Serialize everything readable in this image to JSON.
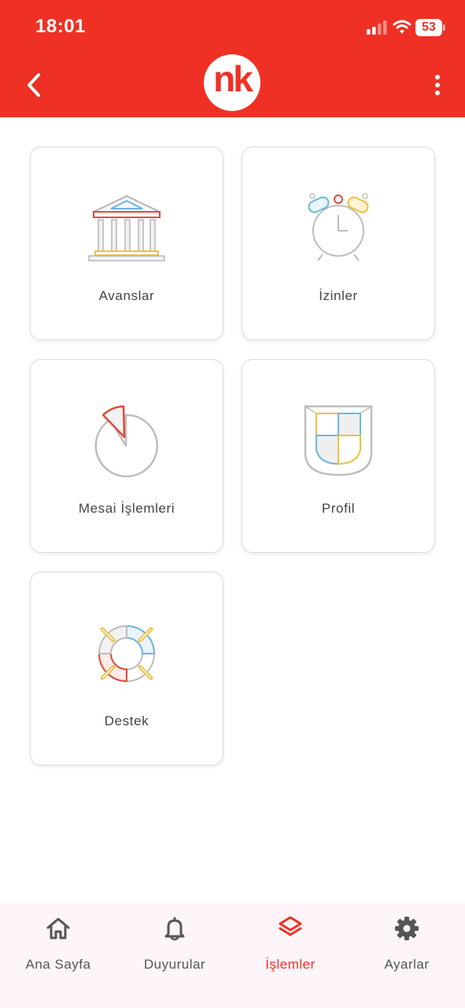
{
  "status_bar": {
    "time": "18:01",
    "battery": "53"
  },
  "header": {
    "logo_text": "nk"
  },
  "colors": {
    "brand": "#ee3124",
    "inactive": "#555555",
    "tabbar_bg": "#fdf5fa"
  },
  "cards": [
    {
      "label": "Avanslar",
      "icon": "bank-building-icon"
    },
    {
      "label": "İzinler",
      "icon": "alarm-clock-icon"
    },
    {
      "label": "Mesai İşlemleri",
      "icon": "pie-chart-icon"
    },
    {
      "label": "Profil",
      "icon": "shield-icon"
    },
    {
      "label": "Destek",
      "icon": "lifebuoy-icon"
    }
  ],
  "tabs": [
    {
      "label": "Ana Sayfa",
      "icon": "home-icon",
      "active": false
    },
    {
      "label": "Duyurular",
      "icon": "bell-icon",
      "active": false
    },
    {
      "label": "İşlemler",
      "icon": "layers-icon",
      "active": true
    },
    {
      "label": "Ayarlar",
      "icon": "gear-icon",
      "active": false
    }
  ]
}
